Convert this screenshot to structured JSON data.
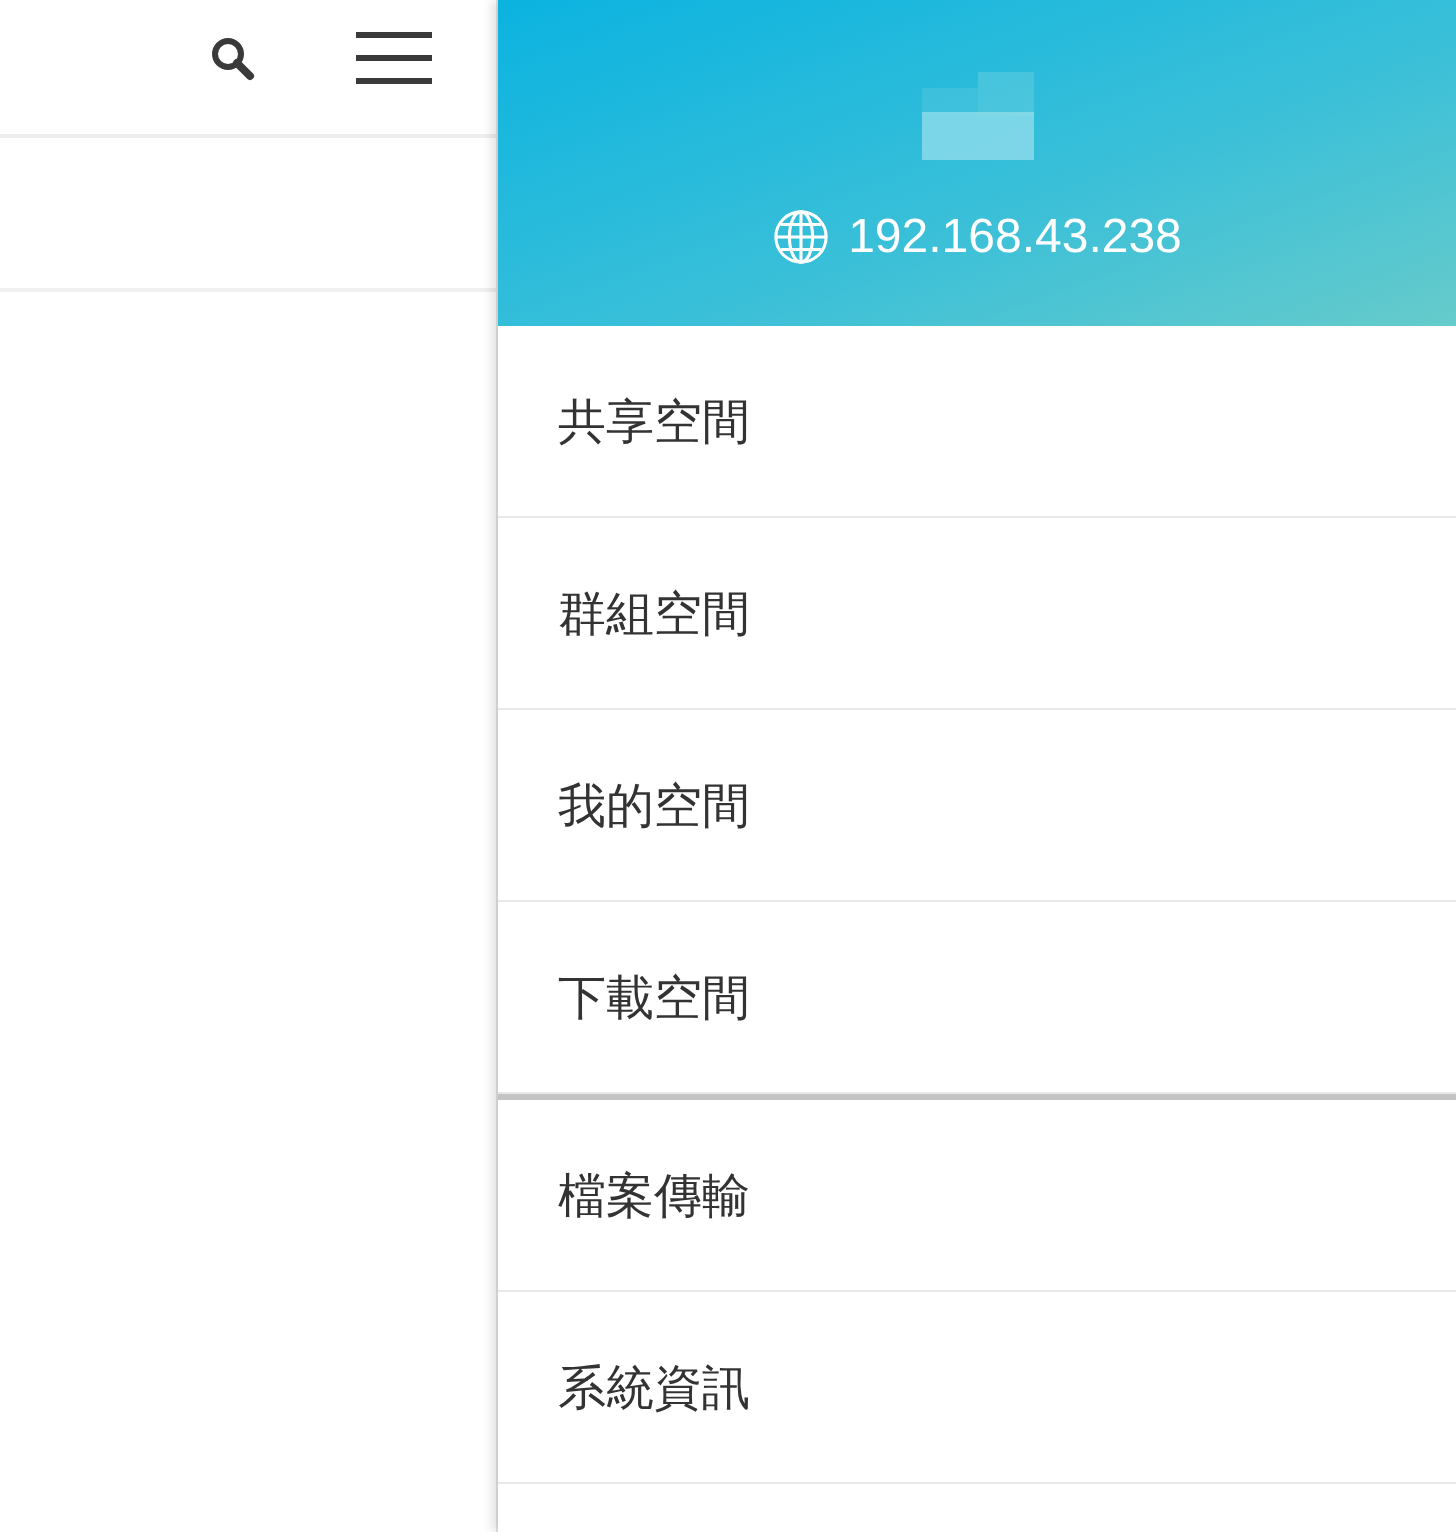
{
  "drawer": {
    "header": {
      "ip_address": "192.168.43.238"
    },
    "menu_groups": [
      {
        "items": [
          {
            "label": "共享空間"
          },
          {
            "label": "群組空間"
          },
          {
            "label": "我的空間"
          },
          {
            "label": "下載空間"
          }
        ]
      },
      {
        "items": [
          {
            "label": "檔案傳輸"
          },
          {
            "label": "系統資訊"
          }
        ]
      }
    ]
  }
}
